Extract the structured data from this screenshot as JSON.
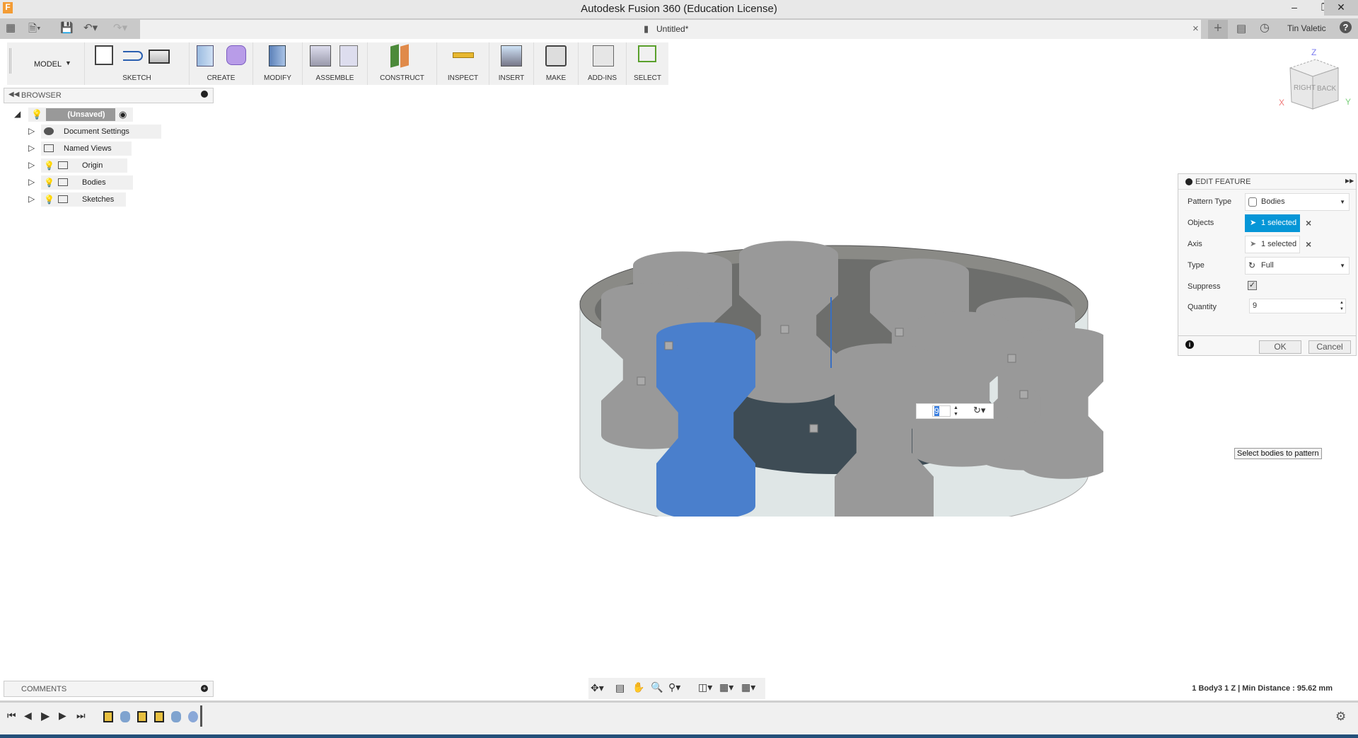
{
  "app": {
    "title": "Autodesk Fusion 360 (Education License)",
    "user": "Tin Valetic",
    "doc_tab": "Untitled*"
  },
  "toolbar": {
    "workspace": "MODEL",
    "groups": [
      "SKETCH",
      "CREATE",
      "MODIFY",
      "ASSEMBLE",
      "CONSTRUCT",
      "INSPECT",
      "INSERT",
      "MAKE",
      "ADD-INS",
      "SELECT"
    ]
  },
  "browser": {
    "title": "BROWSER",
    "root": "(Unsaved)",
    "items": [
      {
        "label": "Document Settings",
        "icon": "gear-icon"
      },
      {
        "label": "Named Views",
        "icon": "folder-icon"
      },
      {
        "label": "Origin",
        "icon": "folder-icon"
      },
      {
        "label": "Bodies",
        "icon": "folder-icon"
      },
      {
        "label": "Sketches",
        "icon": "folder-icon"
      }
    ]
  },
  "viewcube": {
    "right": "RIGHT",
    "back": "BACK",
    "x": "X",
    "y": "Y",
    "z": "Z"
  },
  "edit_feature": {
    "title": "EDIT FEATURE",
    "pattern_type_label": "Pattern Type",
    "pattern_type": "Bodies",
    "objects_label": "Objects",
    "objects_value": "1 selected",
    "axis_label": "Axis",
    "axis_value": "1 selected",
    "type_label": "Type",
    "type_value": "Full",
    "suppress_label": "Suppress",
    "suppress_checked": true,
    "quantity_label": "Quantity",
    "quantity": "9",
    "ok": "OK",
    "cancel": "Cancel",
    "accent": "#0696d7"
  },
  "canvas": {
    "quantity_input": "9",
    "tooltip": "Select bodies to pattern",
    "selected_color": "#4a7fcc"
  },
  "comments": {
    "title": "COMMENTS"
  },
  "status": "1 Body3 1 Z | Min Distance : 95.62 mm"
}
